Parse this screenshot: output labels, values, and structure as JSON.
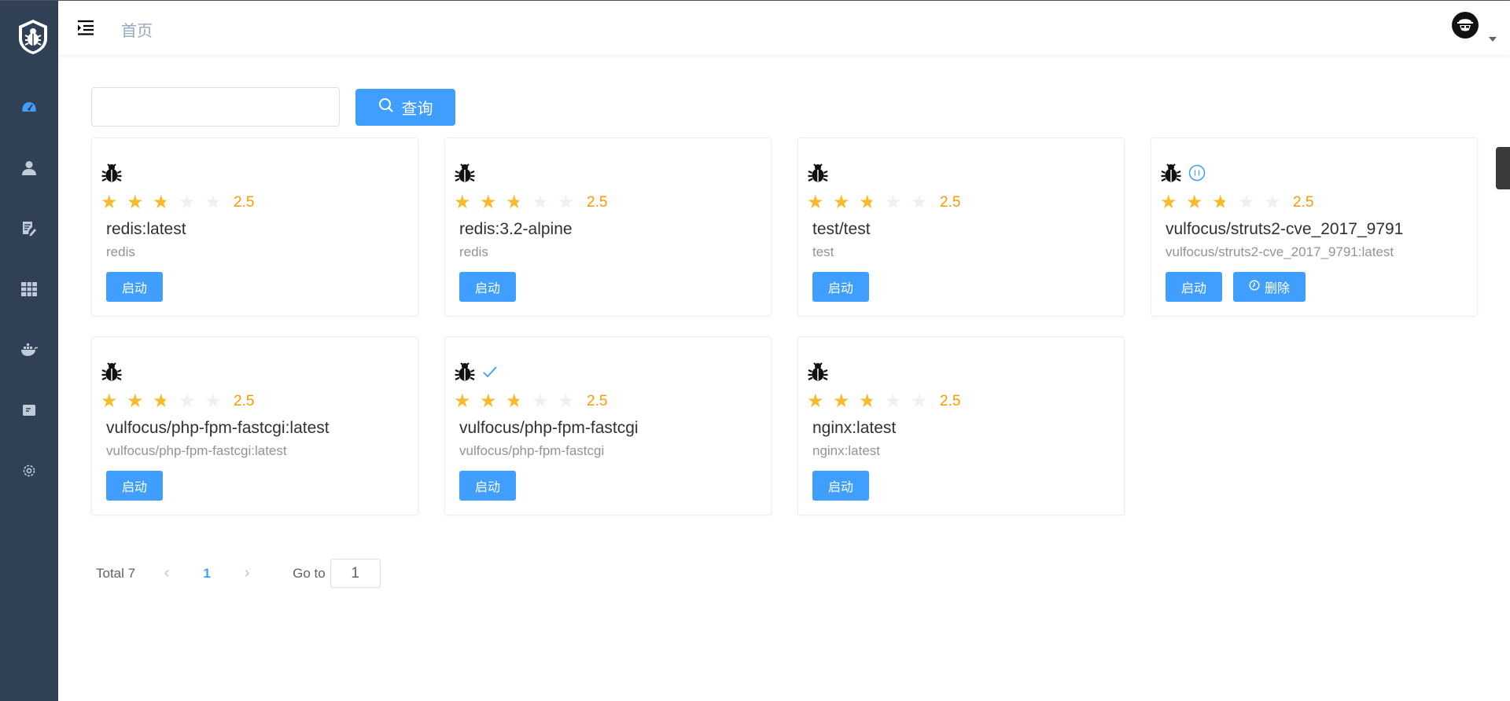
{
  "sidebar": {
    "logo": "bug-shield-logo",
    "items": [
      {
        "icon": "dashboard-icon",
        "active": true
      },
      {
        "icon": "user-icon"
      },
      {
        "icon": "edit-doc-icon"
      },
      {
        "icon": "grid-icon"
      },
      {
        "icon": "docker-icon"
      },
      {
        "icon": "card-icon"
      },
      {
        "icon": "gear-icon"
      }
    ],
    "accent": "#409eff",
    "bg": "#304156"
  },
  "header": {
    "breadcrumb": "首页",
    "avatar": "user-avatar"
  },
  "search": {
    "value": "",
    "button_label": "查询"
  },
  "cards": [
    {
      "name": "redis:latest",
      "sub": "redis",
      "rate": "2.5",
      "status_icon": "",
      "start_label": "启动",
      "delete_label": ""
    },
    {
      "name": "redis:3.2-alpine",
      "sub": "redis",
      "rate": "2.5",
      "status_icon": "",
      "start_label": "启动",
      "delete_label": ""
    },
    {
      "name": "test/test",
      "sub": "test",
      "rate": "2.5",
      "status_icon": "",
      "start_label": "启动",
      "delete_label": ""
    },
    {
      "name": "vulfocus/struts2-cve_2017_9791",
      "sub": "vulfocus/struts2-cve_2017_9791:latest",
      "rate": "2.5",
      "status_icon": "pause-icon",
      "start_label": "启动",
      "delete_label": "删除"
    },
    {
      "name": "vulfocus/php-fpm-fastcgi:latest",
      "sub": "vulfocus/php-fpm-fastcgi:latest",
      "rate": "2.5",
      "status_icon": "",
      "start_label": "启动",
      "delete_label": ""
    },
    {
      "name": "vulfocus/php-fpm-fastcgi",
      "sub": "vulfocus/php-fpm-fastcgi",
      "rate": "2.5",
      "status_icon": "check-icon",
      "start_label": "启动",
      "delete_label": ""
    },
    {
      "name": "nginx:latest",
      "sub": "nginx:latest",
      "rate": "2.5",
      "status_icon": "",
      "start_label": "启动",
      "delete_label": ""
    }
  ],
  "rating": {
    "value": 2.5,
    "max": 5
  },
  "pagination": {
    "total": "Total 7",
    "current": "1",
    "goto_label": "Go to",
    "goto_value": "1"
  },
  "colors": {
    "primary": "#409eff",
    "star": "#f7ba2a",
    "rate_text": "#ff9900"
  }
}
